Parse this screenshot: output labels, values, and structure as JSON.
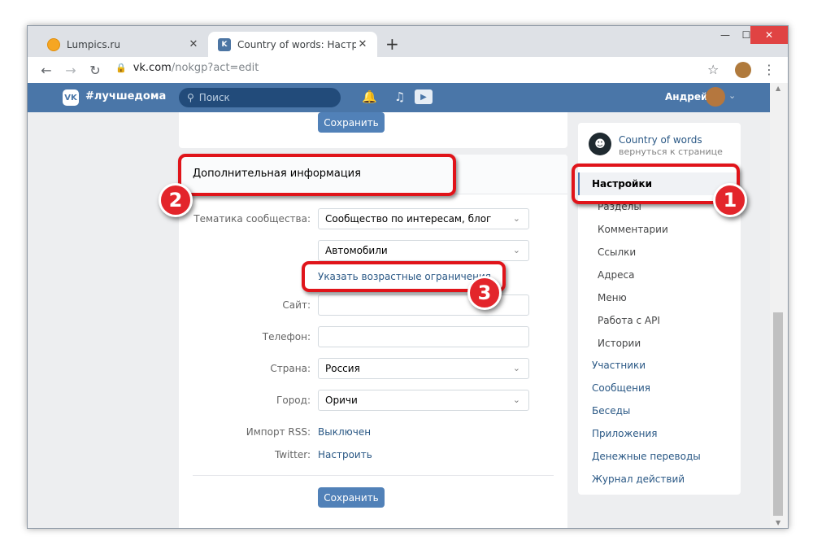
{
  "browser": {
    "tabs": [
      {
        "title": "Lumpics.ru",
        "close": "✕"
      },
      {
        "title": "Country of words: Настройки",
        "close": "✕"
      }
    ],
    "newtab": "+",
    "controls": {
      "minimize": "—",
      "maximize": "☐",
      "close": "✕"
    },
    "url": {
      "host": "vk.com",
      "path": "/nokgp?act=edit"
    }
  },
  "vk_header": {
    "logo": "VK",
    "hashtag": "#лучшедома",
    "search_placeholder": "Поиск",
    "user_name": "Андрей"
  },
  "top_card": {
    "save_label": "Сохранить"
  },
  "main": {
    "section_title": "Дополнительная информация",
    "fields": {
      "topic_label": "Тематика сообщества:",
      "topic_value": "Сообщество по интересам, блог",
      "subtopic_value": "Автомобили",
      "age_link": "Указать возрастные ограничения",
      "site_label": "Сайт:",
      "site_value": "",
      "phone_label": "Телефон:",
      "phone_value": "",
      "country_label": "Страна:",
      "country_value": "Россия",
      "city_label": "Город:",
      "city_value": "Оричи",
      "rss_label": "Импорт RSS:",
      "rss_value": "Выключен",
      "twitter_label": "Twitter:",
      "twitter_value": "Настроить"
    },
    "save_label": "Сохранить"
  },
  "sidebar": {
    "group_name": "Country of words",
    "group_back": "вернуться к странице",
    "items": [
      {
        "label": "Настройки",
        "kind": "active"
      },
      {
        "label": "Разделы",
        "kind": "sub"
      },
      {
        "label": "Комментарии",
        "kind": "sub"
      },
      {
        "label": "Ссылки",
        "kind": "sub"
      },
      {
        "label": "Адреса",
        "kind": "sub"
      },
      {
        "label": "Меню",
        "kind": "sub"
      },
      {
        "label": "Работа с API",
        "kind": "sub"
      },
      {
        "label": "Истории",
        "kind": "sub"
      },
      {
        "label": "Участники",
        "kind": "top"
      },
      {
        "label": "Сообщения",
        "kind": "top"
      },
      {
        "label": "Беседы",
        "kind": "top"
      },
      {
        "label": "Приложения",
        "kind": "top"
      },
      {
        "label": "Денежные переводы",
        "kind": "top"
      },
      {
        "label": "Журнал действий",
        "kind": "top"
      }
    ]
  },
  "annotations": [
    "1",
    "2",
    "3"
  ],
  "colors": {
    "vk_blue": "#4a76a8",
    "button": "#5181b8",
    "link": "#2a5885",
    "annotation_red": "#e0141a"
  }
}
